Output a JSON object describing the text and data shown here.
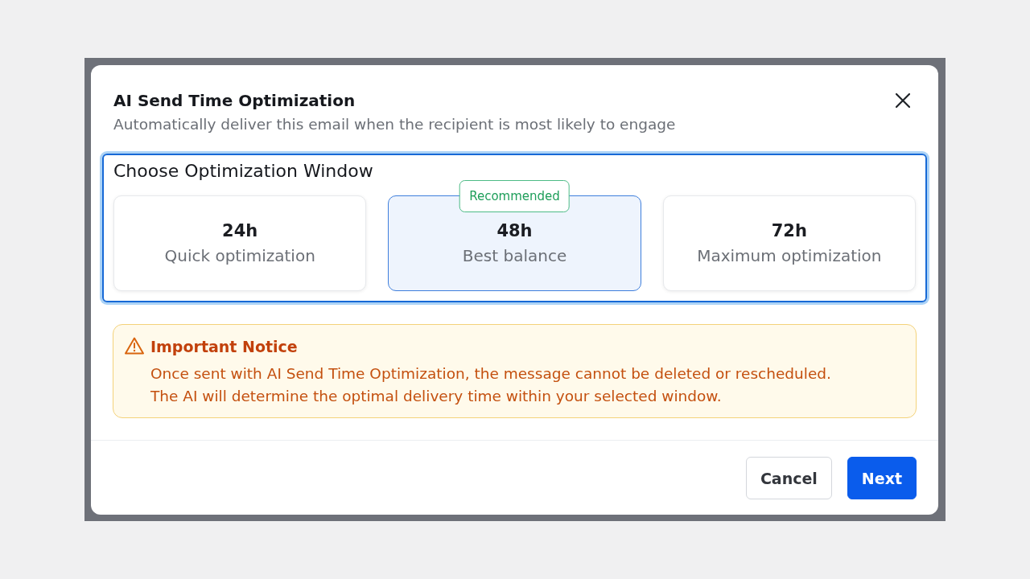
{
  "dialog": {
    "title": "AI Send Time Optimization",
    "subtitle": "Automatically deliver this email when the recipient is most likely to engage"
  },
  "window_picker": {
    "heading": "Choose Optimization Window",
    "options": [
      {
        "duration": "24h",
        "description": "Quick optimization",
        "selected": false
      },
      {
        "duration": "48h",
        "description": "Best balance",
        "selected": true,
        "badge": "Recommended"
      },
      {
        "duration": "72h",
        "description": "Maximum optimization",
        "selected": false
      }
    ]
  },
  "notice": {
    "title": "Important Notice",
    "lines": [
      "Once sent with AI Send Time Optimization, the message cannot be deleted or rescheduled.",
      "The AI will determine the optimal delivery time within your selected window."
    ]
  },
  "buttons": [
    {
      "label": "Cancel",
      "kind": "secondary"
    },
    {
      "label": "Next",
      "kind": "primary"
    }
  ]
}
